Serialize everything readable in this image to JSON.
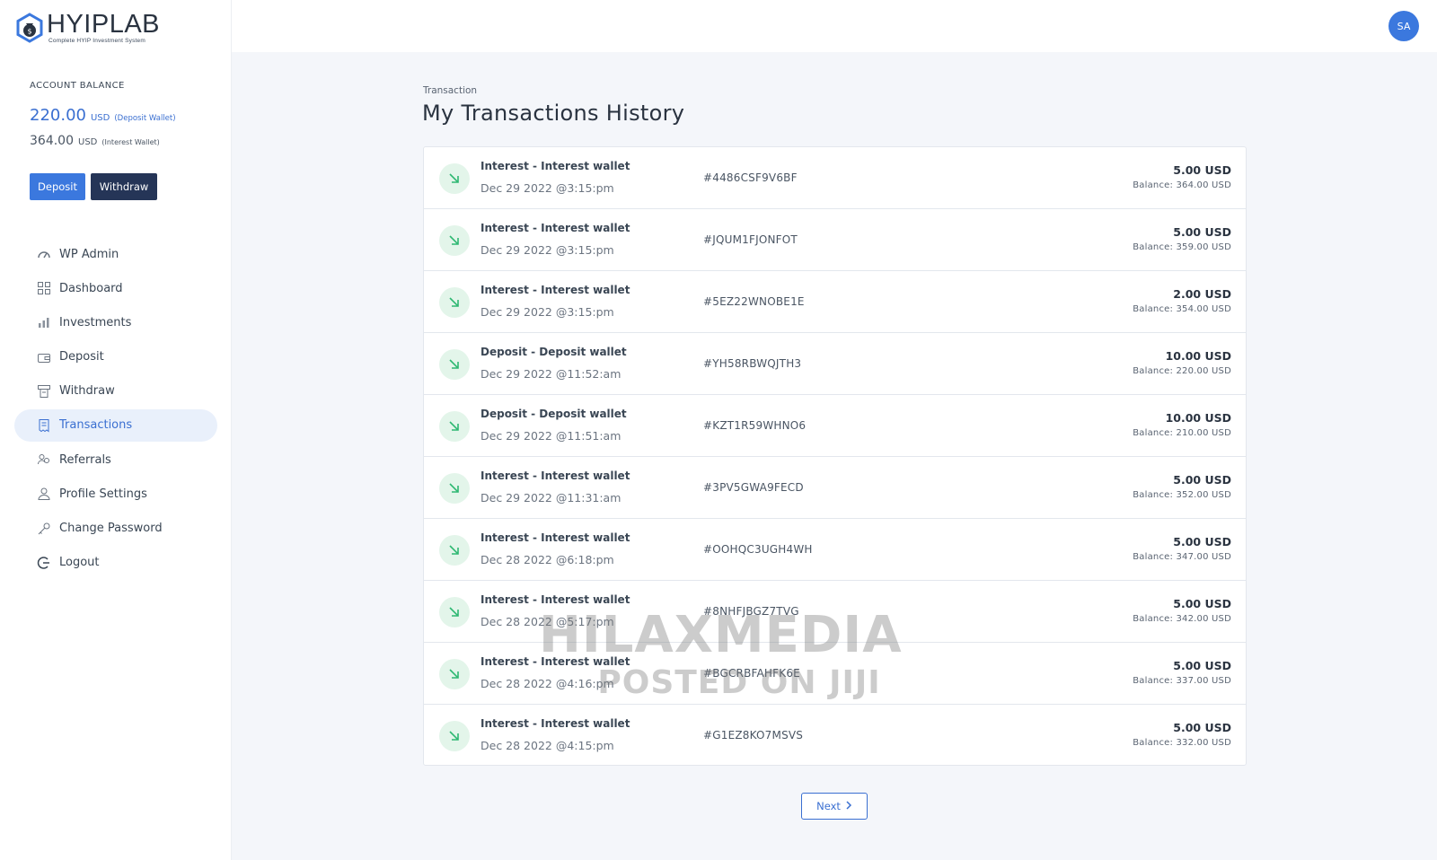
{
  "brand": {
    "name_left": "HYIP",
    "name_right": "LAB",
    "tagline": "Complete HYIP Investment System"
  },
  "account": {
    "label": "ACCOUNT BALANCE",
    "deposit_amount": "220.00",
    "deposit_currency": "USD",
    "deposit_wallet": "(Deposit Wallet)",
    "interest_amount": "364.00",
    "interest_currency": "USD",
    "interest_wallet": "(Interest Wallet)",
    "deposit_button": "Deposit",
    "withdraw_button": "Withdraw"
  },
  "nav": {
    "items": [
      {
        "label": "WP Admin",
        "icon": "dashboard-gauge-icon"
      },
      {
        "label": "Dashboard",
        "icon": "grid-icon"
      },
      {
        "label": "Investments",
        "icon": "chart-icon"
      },
      {
        "label": "Deposit",
        "icon": "wallet-icon"
      },
      {
        "label": "Withdraw",
        "icon": "atm-icon"
      },
      {
        "label": "Transactions",
        "icon": "receipt-icon",
        "active": true
      },
      {
        "label": "Referrals",
        "icon": "users-icon"
      },
      {
        "label": "Profile Settings",
        "icon": "user-icon"
      },
      {
        "label": "Change Password",
        "icon": "key-icon"
      },
      {
        "label": "Logout",
        "icon": "logout-icon"
      }
    ]
  },
  "header": {
    "avatar_initials": "SA"
  },
  "page": {
    "breadcrumb": "Transaction",
    "title": "My Transactions History"
  },
  "transactions": [
    {
      "title": "Interest - Interest wallet",
      "date": "Dec 29 2022 @3:15:pm",
      "id": "#4486CSF9V6BF",
      "amount": "5.00 USD",
      "balance": "Balance: 364.00 USD"
    },
    {
      "title": "Interest - Interest wallet",
      "date": "Dec 29 2022 @3:15:pm",
      "id": "#JQUM1FJONFOT",
      "amount": "5.00 USD",
      "balance": "Balance: 359.00 USD"
    },
    {
      "title": "Interest - Interest wallet",
      "date": "Dec 29 2022 @3:15:pm",
      "id": "#5EZ22WNOBE1E",
      "amount": "2.00 USD",
      "balance": "Balance: 354.00 USD"
    },
    {
      "title": "Deposit - Deposit wallet",
      "date": "Dec 29 2022 @11:52:am",
      "id": "#YH58RBWQJTH3",
      "amount": "10.00 USD",
      "balance": "Balance: 220.00 USD"
    },
    {
      "title": "Deposit - Deposit wallet",
      "date": "Dec 29 2022 @11:51:am",
      "id": "#KZT1R59WHNO6",
      "amount": "10.00 USD",
      "balance": "Balance: 210.00 USD"
    },
    {
      "title": "Interest - Interest wallet",
      "date": "Dec 29 2022 @11:31:am",
      "id": "#3PV5GWA9FECD",
      "amount": "5.00 USD",
      "balance": "Balance: 352.00 USD"
    },
    {
      "title": "Interest - Interest wallet",
      "date": "Dec 28 2022 @6:18:pm",
      "id": "#OOHQC3UGH4WH",
      "amount": "5.00 USD",
      "balance": "Balance: 347.00 USD"
    },
    {
      "title": "Interest - Interest wallet",
      "date": "Dec 28 2022 @5:17:pm",
      "id": "#8NHFJBGZ7TVG",
      "amount": "5.00 USD",
      "balance": "Balance: 342.00 USD"
    },
    {
      "title": "Interest - Interest wallet",
      "date": "Dec 28 2022 @4:16:pm",
      "id": "#BGCRBFAHFK6E",
      "amount": "5.00 USD",
      "balance": "Balance: 337.00 USD"
    },
    {
      "title": "Interest - Interest wallet",
      "date": "Dec 28 2022 @4:15:pm",
      "id": "#G1EZ8KO7MSVS",
      "amount": "5.00 USD",
      "balance": "Balance: 332.00 USD"
    }
  ],
  "pagination": {
    "next_label": "Next"
  },
  "watermark": {
    "line1": "HILAXMEDIA",
    "line2": "POSTED ON JIJI"
  },
  "colors": {
    "accent": "#3b78de",
    "dark_button": "#253557",
    "success_icon_bg": "#e3f5ea",
    "success_arrow": "#2eb872"
  }
}
